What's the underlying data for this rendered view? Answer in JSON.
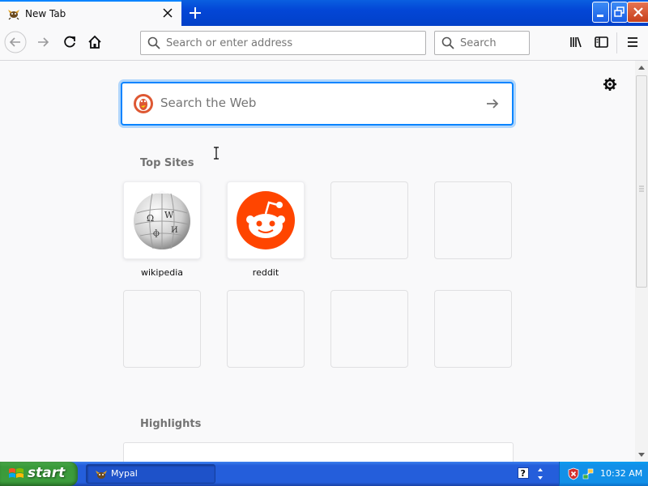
{
  "browser": {
    "tab": {
      "title": "New Tab"
    },
    "urlbar": {
      "placeholder": "Search or enter address"
    },
    "searchbar": {
      "placeholder": "Search"
    }
  },
  "newtab": {
    "web_search": {
      "placeholder": "Search the Web"
    },
    "top_sites": {
      "title": "Top Sites",
      "tiles": [
        {
          "label": "wikipedia",
          "icon": "wikipedia-globe-icon"
        },
        {
          "label": "reddit",
          "icon": "reddit-alien-icon"
        }
      ]
    },
    "highlights": {
      "title": "Highlights"
    }
  },
  "taskbar": {
    "start_label": "start",
    "task_label": "Mypal",
    "clock": "10:32 AM"
  },
  "colors": {
    "accent": "#0a84ff",
    "reddit": "#ff4500",
    "xp_taskbar": "#245edb",
    "xp_start": "#3c9c3c"
  }
}
